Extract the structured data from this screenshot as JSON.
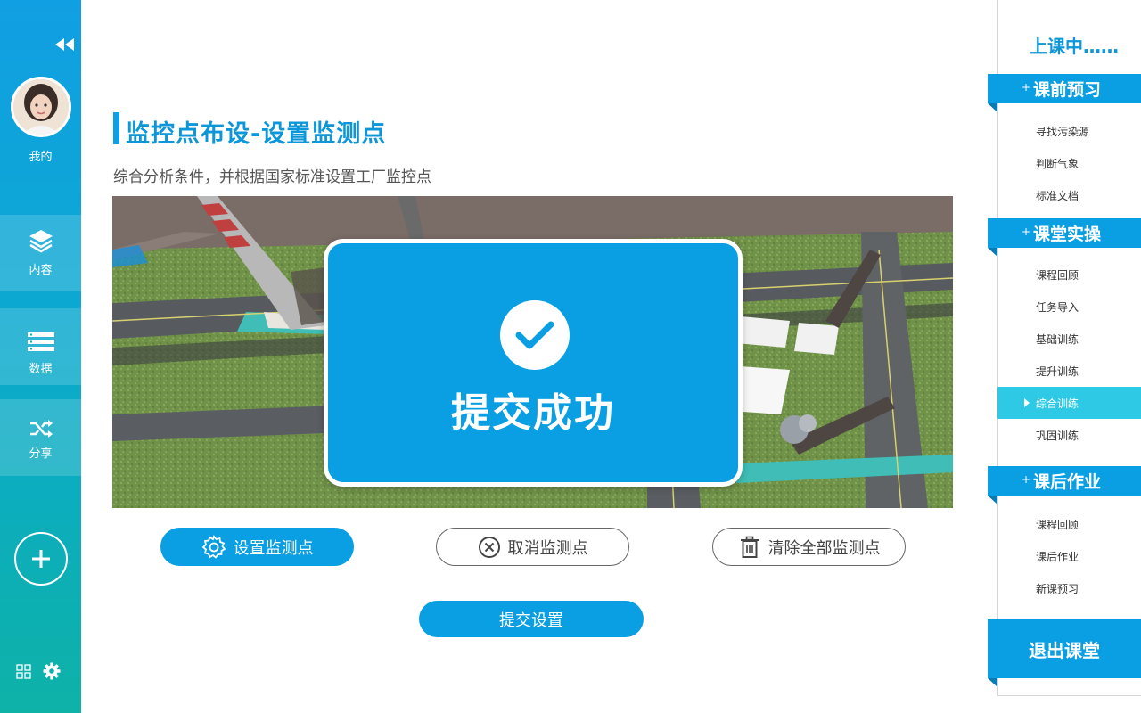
{
  "sidebar": {
    "profile_label": "我的",
    "nav": [
      {
        "label": "内容",
        "icon": "layers-icon"
      },
      {
        "label": "数据",
        "icon": "database-icon"
      },
      {
        "label": "分享",
        "icon": "shuffle-icon"
      }
    ]
  },
  "main": {
    "title": "监控点布设-设置监测点",
    "subtitle": "综合分析条件，并根据国家标准设置工厂监控点",
    "modal_text": "提交成功",
    "buttons": {
      "set": "设置监测点",
      "cancel": "取消监测点",
      "clear": "清除全部监测点",
      "submit": "提交设置"
    }
  },
  "right_panel": {
    "status": "上课中……",
    "sections": [
      {
        "title": "课前预习",
        "items": [
          "寻找污染源",
          "判断气象",
          "标准文档"
        ]
      },
      {
        "title": "课堂实操",
        "items": [
          "课程回顾",
          "任务导入",
          "基础训练",
          "提升训练",
          "综合训练",
          "巩固训练"
        ]
      },
      {
        "title": "课后作业",
        "items": [
          "课程回顾",
          "课后作业",
          "新课预习"
        ]
      }
    ],
    "active_item": "综合训练",
    "exit": "退出课堂"
  },
  "colors": {
    "primary": "#0a9fe2",
    "active": "#2ec9e4",
    "title": "#0d96d8"
  }
}
